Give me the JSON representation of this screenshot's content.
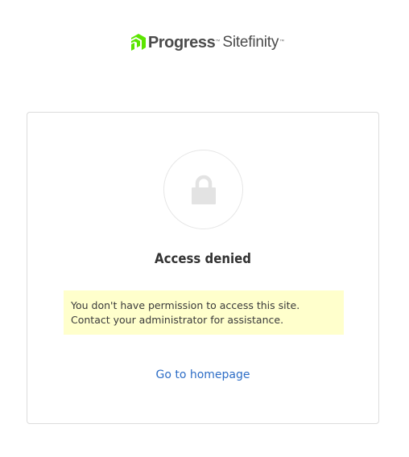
{
  "logo": {
    "brand": "Progress",
    "product": "Sitefinity",
    "trademark": "™",
    "colors": {
      "mark": "#5ce500",
      "text": "#4b4b4b"
    }
  },
  "card": {
    "icon": "lock-icon",
    "title": "Access denied",
    "message": "You don't have permission to access this site. Contact your administrator for assistance.",
    "link_label": "Go to homepage",
    "colors": {
      "message_bg": "#ffffcc",
      "link": "#2d6dc6",
      "border": "#dcdcdc"
    }
  }
}
